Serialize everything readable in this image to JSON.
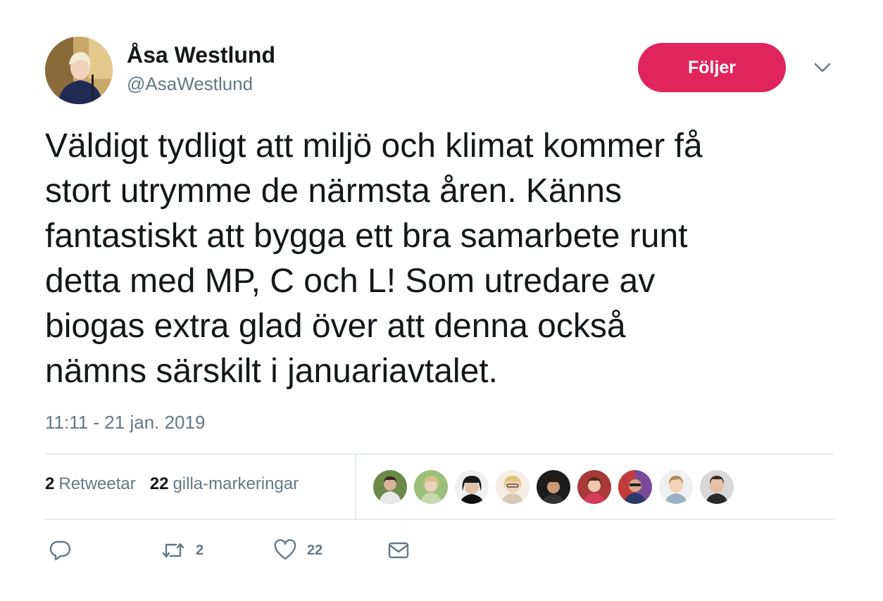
{
  "author": {
    "display_name": "Åsa Westlund",
    "handle": "@AsaWestlund"
  },
  "follow_button": {
    "label": "Följer",
    "color": "#e0245e"
  },
  "tweet": {
    "text": "Väldigt tydligt att miljö och klimat kommer få\nstort utrymme de närmsta åren. Känns\nfantastiskt att bygga ett bra samarbete runt\ndetta med MP, C och L! Som utredare av\nbiogas extra glad över att denna också\nnämns särskilt i januariavtalet.",
    "timestamp": "11:11 - 21 jan. 2019"
  },
  "stats": {
    "retweets": {
      "count": "2",
      "label": "Retweetar"
    },
    "likes": {
      "count": "22",
      "label": "gilla-markeringar"
    }
  },
  "likers_count_shown": 9,
  "actions": {
    "reply": {
      "icon": "reply-icon"
    },
    "retweet": {
      "icon": "retweet-icon",
      "count": "2"
    },
    "like": {
      "icon": "heart-icon",
      "count": "22"
    },
    "message": {
      "icon": "envelope-icon"
    }
  },
  "colors": {
    "text_primary": "#14171a",
    "text_secondary": "#657786",
    "divider": "#e6ecf0",
    "accent": "#e0245e"
  }
}
